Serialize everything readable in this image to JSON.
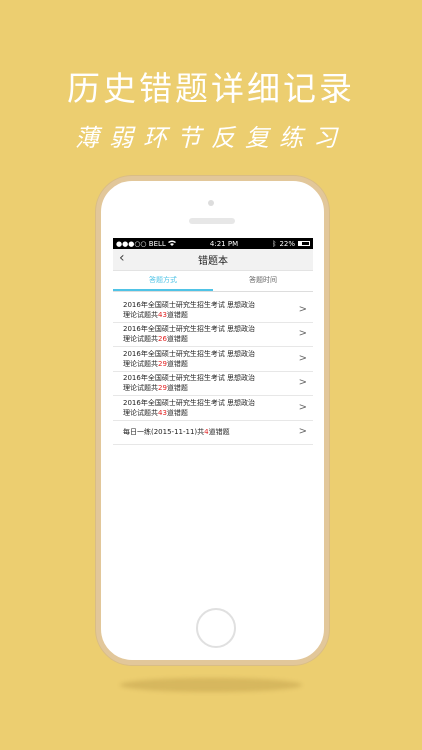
{
  "headline": "历史错题详细记录",
  "subline": "薄弱环节反复练习",
  "statusbar": {
    "carrier": "●●●○○ BELL",
    "time": "4:21 PM",
    "battery": "22%"
  },
  "navbar": {
    "title": "错题本"
  },
  "tabs": [
    {
      "label": "答题方式"
    },
    {
      "label": "答题时间"
    }
  ],
  "rows": [
    {
      "line1": "2016年全国硕士研究生招生考试 思想政治",
      "prefix": "理论试题共",
      "count": "43",
      "suffix": "道错题"
    },
    {
      "line1": "2016年全国硕士研究生招生考试 思想政治",
      "prefix": "理论试题共",
      "count": "26",
      "suffix": "道错题"
    },
    {
      "line1": "2016年全国硕士研究生招生考试 思想政治",
      "prefix": "理论试题共",
      "count": "29",
      "suffix": "道错题"
    },
    {
      "line1": "2016年全国硕士研究生招生考试 思想政治",
      "prefix": "理论试题共",
      "count": "29",
      "suffix": "道错题"
    },
    {
      "line1": "2016年全国硕士研究生招生考试 思想政治",
      "prefix": "理论试题共",
      "count": "43",
      "suffix": "道错题"
    }
  ],
  "daily": {
    "prefix": "每日一练(2015-11-11)共",
    "count": "4",
    "suffix": "道错题"
  },
  "colors": {
    "background": "#ecce70",
    "accent": "#4fc3e6",
    "count": "#e02020"
  }
}
